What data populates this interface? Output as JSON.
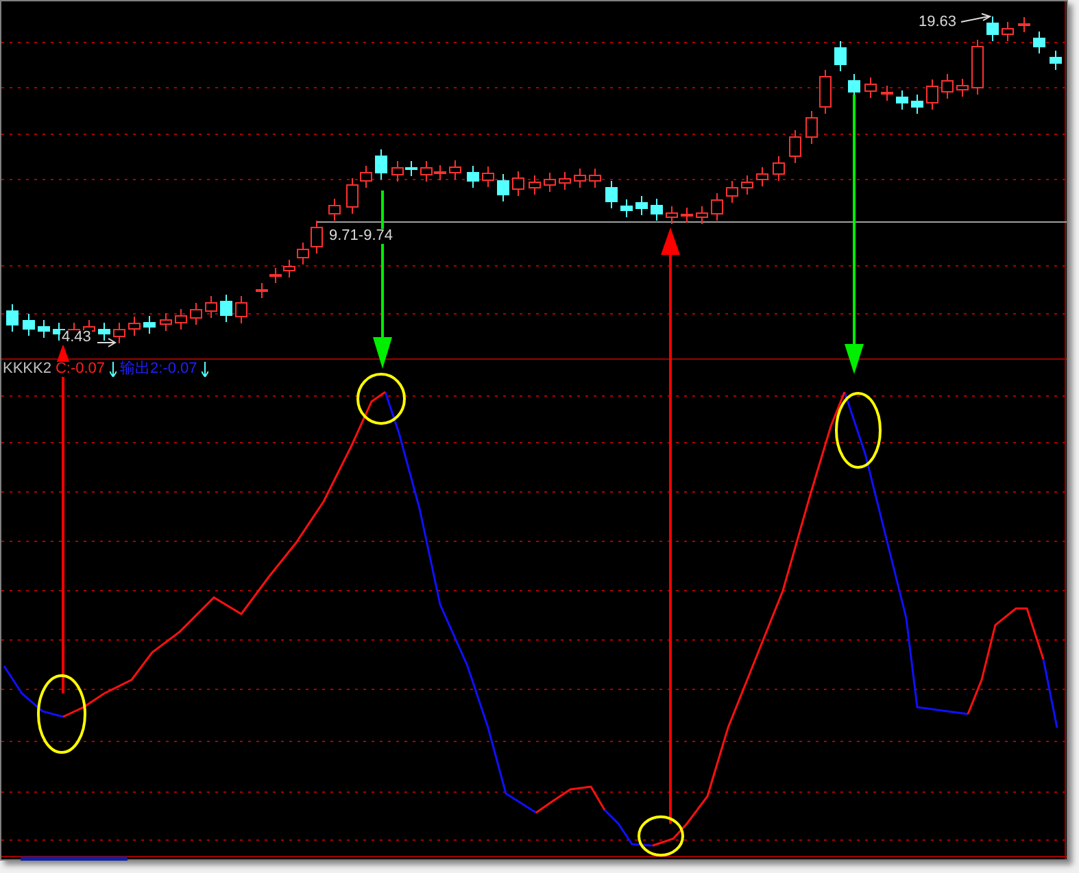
{
  "price_panel": {
    "annotations": [
      {
        "text": "4.43"
      },
      {
        "text": "9.71-9.74"
      },
      {
        "text": "19.63"
      }
    ]
  },
  "indicator_panel": {
    "legend": [
      {
        "text": "KKKK2",
        "color": "#c0c0c0"
      },
      {
        "text": "C:-0.07",
        "color": "#ff2020"
      },
      {
        "text": "输出2:-0.07",
        "color": "#2020ff"
      }
    ]
  }
}
